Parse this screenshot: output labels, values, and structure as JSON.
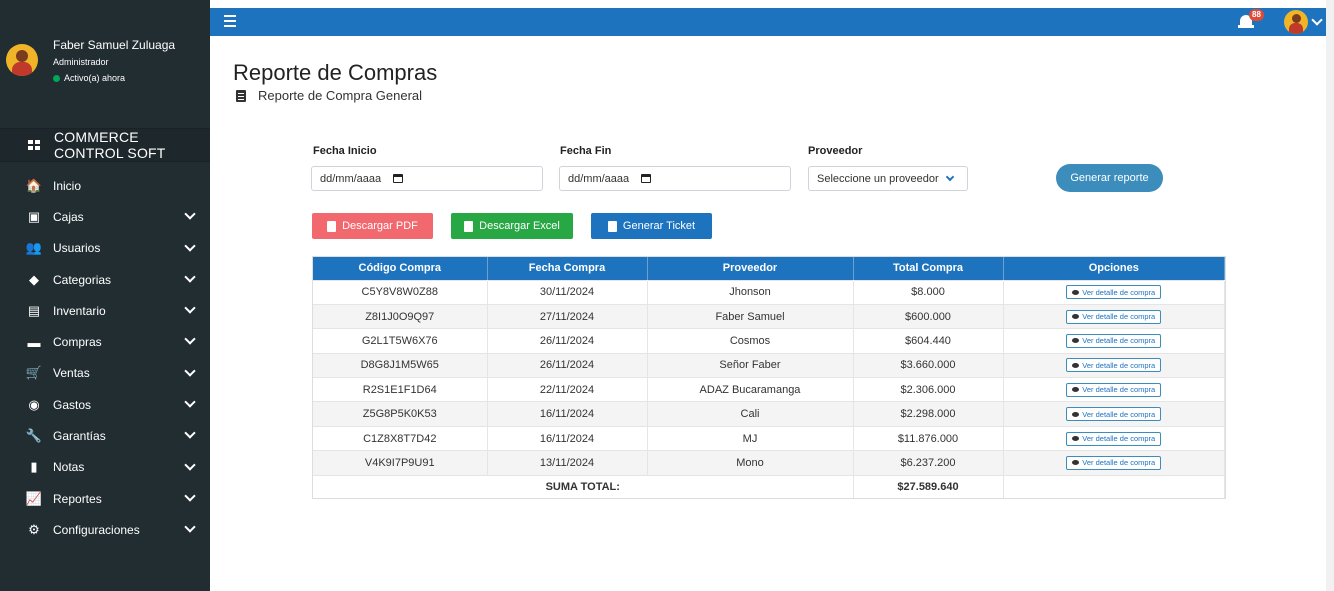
{
  "user": {
    "name": "Faber Samuel Zuluaga",
    "role": "Administrador",
    "status": "Activo(a) ahora"
  },
  "brand": {
    "name": "COMMERCE CONTROL SOFT"
  },
  "sidebar": {
    "items": [
      {
        "label": "Inicio",
        "icon": "home-icon",
        "glyph": "🏠",
        "has_sub": false
      },
      {
        "label": "Cajas",
        "icon": "cash-register-icon",
        "glyph": "▣",
        "has_sub": true
      },
      {
        "label": "Usuarios",
        "icon": "users-icon",
        "glyph": "👥",
        "has_sub": true
      },
      {
        "label": "Categorias",
        "icon": "tag-icon",
        "glyph": "◆",
        "has_sub": true
      },
      {
        "label": "Inventario",
        "icon": "box-icon",
        "glyph": "▤",
        "has_sub": true
      },
      {
        "label": "Compras",
        "icon": "truck-icon",
        "glyph": "▬",
        "has_sub": true
      },
      {
        "label": "Ventas",
        "icon": "cart-icon",
        "glyph": "🛒",
        "has_sub": true
      },
      {
        "label": "Gastos",
        "icon": "coins-icon",
        "glyph": "◉",
        "has_sub": true
      },
      {
        "label": "Garantías",
        "icon": "wrench-icon",
        "glyph": "🔧",
        "has_sub": true
      },
      {
        "label": "Notas",
        "icon": "note-icon",
        "glyph": "▮",
        "has_sub": true
      },
      {
        "label": "Reportes",
        "icon": "chart-line-icon",
        "glyph": "📈",
        "has_sub": true
      },
      {
        "label": "Configuraciones",
        "icon": "cogs-icon",
        "glyph": "⚙",
        "has_sub": true
      }
    ]
  },
  "topbar": {
    "notifications_count": "88"
  },
  "page": {
    "title": "Reporte de Compras",
    "subtitle": "Reporte de Compra General"
  },
  "filters": {
    "start_label": "Fecha Inicio",
    "start_value": "dd/mm/aaaa",
    "end_label": "Fecha Fin",
    "end_value": "dd/mm/aaaa",
    "provider_label": "Proveedor",
    "provider_value": "Seleccione un proveedor",
    "generate_label": "Generar reporte"
  },
  "actions": {
    "pdf_label": "Descargar PDF",
    "excel_label": "Descargar Excel",
    "ticket_label": "Generar Ticket"
  },
  "colors": {
    "primary": "#1e73be",
    "pdf": "#f2686f",
    "excel": "#28a745",
    "ticket": "#1e73be",
    "sidebar": "#222d32"
  },
  "table": {
    "headers": [
      "Código Compra",
      "Fecha Compra",
      "Proveedor",
      "Total Compra",
      "Opciones"
    ],
    "detail_label": "Ver detalle de compra",
    "rows": [
      {
        "code": "C5Y8V8W0Z88",
        "date": "30/11/2024",
        "provider": "Jhonson",
        "total": "$8.000"
      },
      {
        "code": "Z8I1J0O9Q97",
        "date": "27/11/2024",
        "provider": "Faber Samuel",
        "total": "$600.000"
      },
      {
        "code": "G2L1T5W6X76",
        "date": "26/11/2024",
        "provider": "Cosmos",
        "total": "$604.440"
      },
      {
        "code": "D8G8J1M5W65",
        "date": "26/11/2024",
        "provider": "Señor Faber",
        "total": "$3.660.000"
      },
      {
        "code": "R2S1E1F1D64",
        "date": "22/11/2024",
        "provider": "ADAZ Bucaramanga",
        "total": "$2.306.000"
      },
      {
        "code": "Z5G8P5K0K53",
        "date": "16/11/2024",
        "provider": "Cali",
        "total": "$2.298.000"
      },
      {
        "code": "C1Z8X8T7D42",
        "date": "16/11/2024",
        "provider": "MJ",
        "total": "$11.876.000"
      },
      {
        "code": "V4K9I7P9U91",
        "date": "13/11/2024",
        "provider": "Mono",
        "total": "$6.237.200"
      }
    ],
    "sum_label": "SUMA TOTAL:",
    "sum_value": "$27.589.640"
  }
}
